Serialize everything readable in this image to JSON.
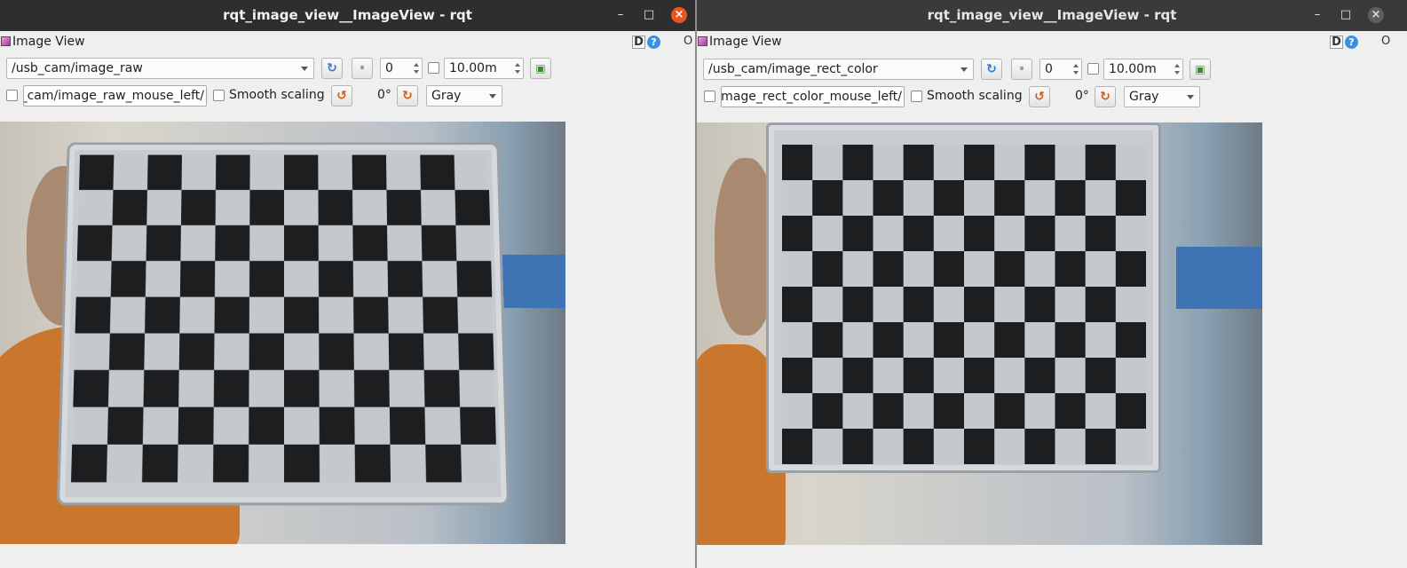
{
  "windows": [
    {
      "title": "rqt_image_view__ImageView - rqt",
      "plugin_title": "Image View",
      "d_label": "D",
      "help_label": "?",
      "o_label": "O",
      "topic": "/usb_cam/image_raw",
      "spin_value": "0",
      "max_range": "10.00m",
      "mouse_topic": "/usb_cam/image_raw_mouse_left",
      "smooth_label": "Smooth scaling",
      "rotation": "0°",
      "color_scheme": "Gray",
      "image_desc": "raw"
    },
    {
      "title": "rqt_image_view__ImageView - rqt",
      "plugin_title": "Image View",
      "d_label": "D",
      "help_label": "?",
      "o_label": "O",
      "topic": "/usb_cam/image_rect_color",
      "spin_value": "0",
      "max_range": "10.00m",
      "mouse_topic": "/usb_cam/image_rect_color_mouse_left",
      "smooth_label": "Smooth scaling",
      "rotation": "0°",
      "color_scheme": "Gray",
      "image_desc": "rect"
    }
  ],
  "icons": {
    "minimize": "–",
    "maximize": "□",
    "close": "×",
    "refresh": "↻",
    "pause": "⏸",
    "save": "▣",
    "rotate_left": "↺",
    "rotate_right": "↻"
  }
}
